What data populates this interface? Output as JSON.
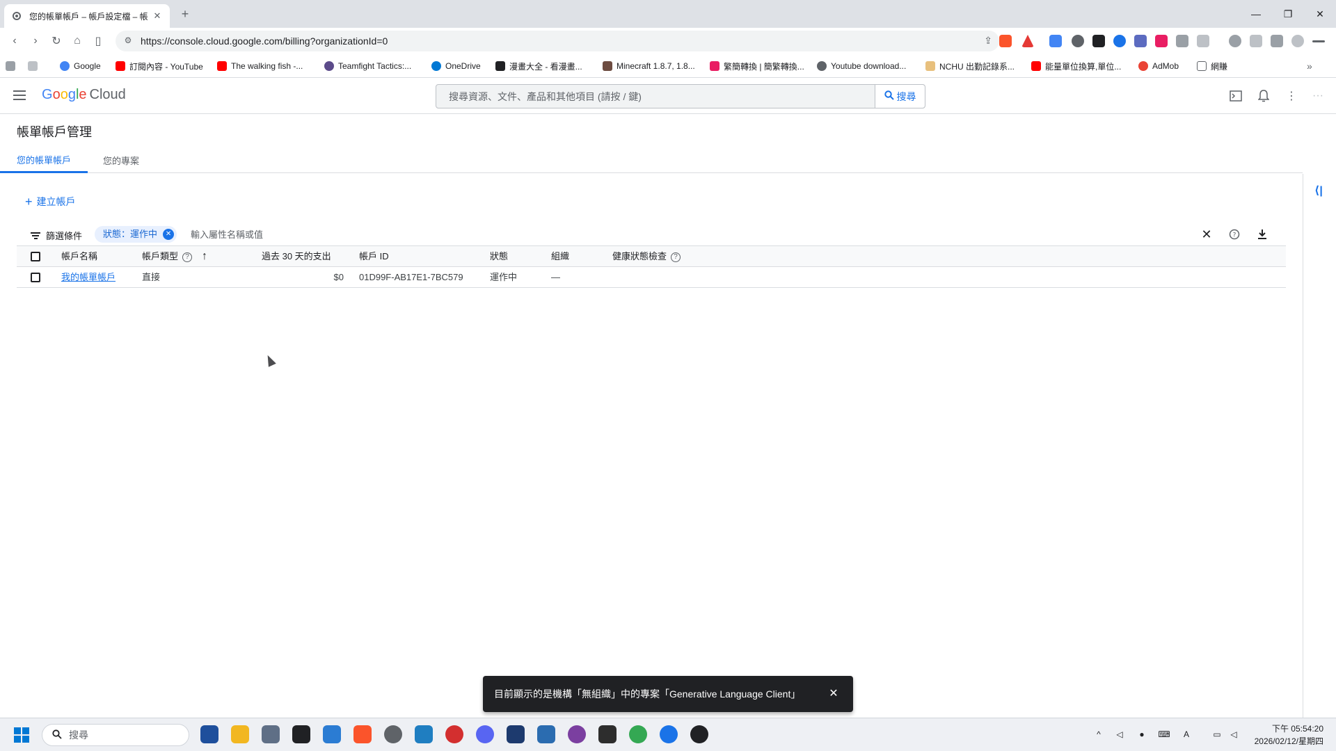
{
  "browser": {
    "tab_title": "您的帳單帳戶 – 帳戶設定檔 – 帳",
    "url": "https://console.cloud.google.com/billing?organizationId=0",
    "bookmarks": [
      "Google",
      "訂閱內容 - YouTube",
      "The walking fish -...",
      "Teamfight Tactics:...",
      "OneDrive",
      "漫畫大全 - 看漫畫...",
      "Minecraft 1.8.7, 1.8...",
      "繁簡轉換 | 簡繁轉換...",
      "Youtube download...",
      "NCHU 出勤記錄系...",
      "能量單位換算,單位...",
      "AdMob",
      "網賺"
    ]
  },
  "header": {
    "logo_google": "Google",
    "logo_cloud": "Cloud",
    "search_placeholder": "搜尋資源、文件、產品和其他項目 (請按 / 鍵)",
    "search_button": "搜尋"
  },
  "page": {
    "title": "帳單帳戶管理",
    "tabs": [
      {
        "label": "您的帳單帳戶",
        "active": true
      },
      {
        "label": "您的專案",
        "active": false
      }
    ],
    "create_button": "建立帳戶"
  },
  "filter": {
    "label": "篩選條件",
    "chip": "狀態：運作中",
    "placeholder": "輸入屬性名稱或值"
  },
  "table": {
    "headers": {
      "name": "帳戶名稱",
      "type": "帳戶類型",
      "spend": "過去 30 天的支出",
      "id": "帳戶 ID",
      "status": "狀態",
      "org": "組織",
      "health": "健康狀態檢查"
    },
    "rows": [
      {
        "name": "我的帳單帳戶",
        "type": "直接",
        "spend": "$0",
        "id": "01D99F-AB17E1-7BC579",
        "status": "運作中",
        "org": "—",
        "health": ""
      }
    ]
  },
  "snackbar": {
    "message": "目前顯示的是機構「無組織」中的專案「Generative Language Client」"
  },
  "taskbar": {
    "search_label": "搜尋",
    "time": "下午 05:54:20",
    "date": "2026/02/12/星期四"
  },
  "colors": {
    "accent": "#1a73e8",
    "chip_bg": "#e8f0fe",
    "snackbar_bg": "#202124"
  }
}
